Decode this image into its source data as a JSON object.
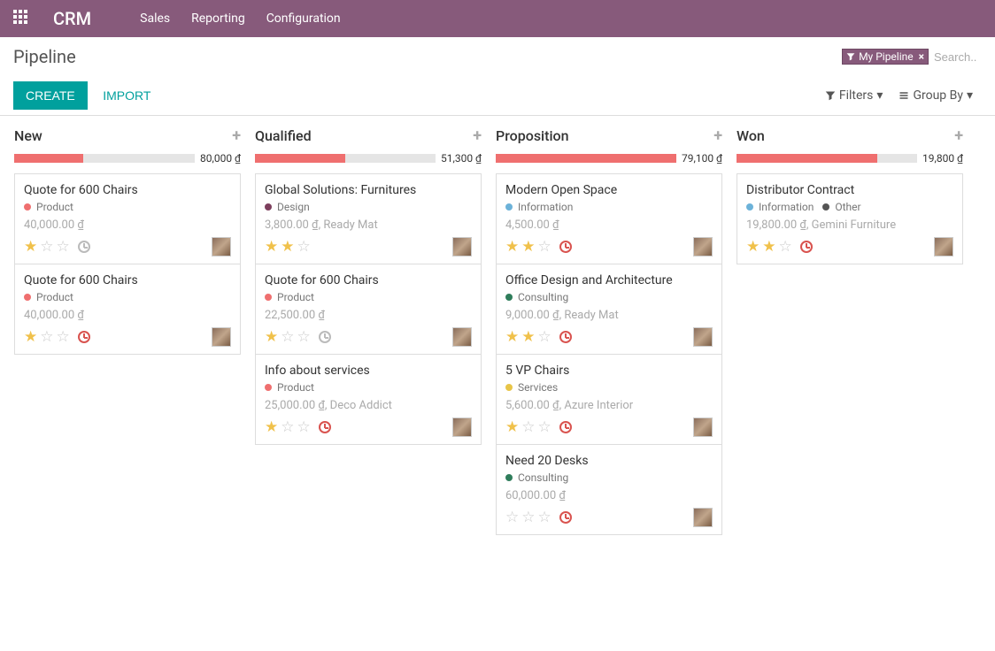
{
  "nav": {
    "brand": "CRM",
    "items": [
      "Sales",
      "Reporting",
      "Configuration"
    ]
  },
  "breadcrumb": "Pipeline",
  "search": {
    "tag": "My Pipeline",
    "placeholder": "Search..."
  },
  "buttons": {
    "create": "CREATE",
    "import": "IMPORT"
  },
  "tools": {
    "filters": "Filters",
    "group_by": "Group By"
  },
  "tag_colors": {
    "Product": "#ef6f6f",
    "Design": "#7d3f5d",
    "Information": "#6cb2d9",
    "Consulting": "#2f7d5b",
    "Services": "#e8c548",
    "Other": "#555"
  },
  "columns": [
    {
      "title": "New",
      "amount": "80,000 ₫",
      "bar_pct": 38,
      "cards": [
        {
          "title": "Quote for 600 Chairs",
          "tags": [
            "Product"
          ],
          "sub": "40,000.00 ₫",
          "stars": 1,
          "clock": "gray"
        },
        {
          "title": "Quote for 600 Chairs",
          "tags": [
            "Product"
          ],
          "sub": "40,000.00 ₫",
          "stars": 1,
          "clock": "red"
        }
      ]
    },
    {
      "title": "Qualified",
      "amount": "51,300 ₫",
      "bar_pct": 50,
      "cards": [
        {
          "title": "Global Solutions: Furnitures",
          "tags": [
            "Design"
          ],
          "sub": "3,800.00 ₫, Ready Mat",
          "stars": 2,
          "clock": null
        },
        {
          "title": "Quote for 600 Chairs",
          "tags": [
            "Product"
          ],
          "sub": "22,500.00 ₫",
          "stars": 1,
          "clock": "gray"
        },
        {
          "title": "Info about services",
          "tags": [
            "Product"
          ],
          "sub": "25,000.00 ₫, Deco Addict",
          "stars": 1,
          "clock": "red"
        }
      ]
    },
    {
      "title": "Proposition",
      "amount": "79,100 ₫",
      "bar_pct": 100,
      "cards": [
        {
          "title": "Modern Open Space",
          "tags": [
            "Information"
          ],
          "sub": "4,500.00 ₫",
          "stars": 2,
          "clock": "red"
        },
        {
          "title": "Office Design and Architecture",
          "tags": [
            "Consulting"
          ],
          "sub": "9,000.00 ₫, Ready Mat",
          "stars": 2,
          "clock": "red"
        },
        {
          "title": "5 VP Chairs",
          "tags": [
            "Services"
          ],
          "sub": "5,600.00 ₫, Azure Interior",
          "stars": 1,
          "clock": "red"
        },
        {
          "title": "Need 20 Desks",
          "tags": [
            "Consulting"
          ],
          "sub": "60,000.00 ₫",
          "stars": 0,
          "clock": "red"
        }
      ]
    },
    {
      "title": "Won",
      "amount": "19,800 ₫",
      "bar_pct": 78,
      "cards": [
        {
          "title": "Distributor Contract",
          "tags": [
            "Information",
            "Other"
          ],
          "sub": "19,800.00 ₫, Gemini Furniture",
          "stars": 2,
          "clock": "red"
        }
      ]
    }
  ]
}
